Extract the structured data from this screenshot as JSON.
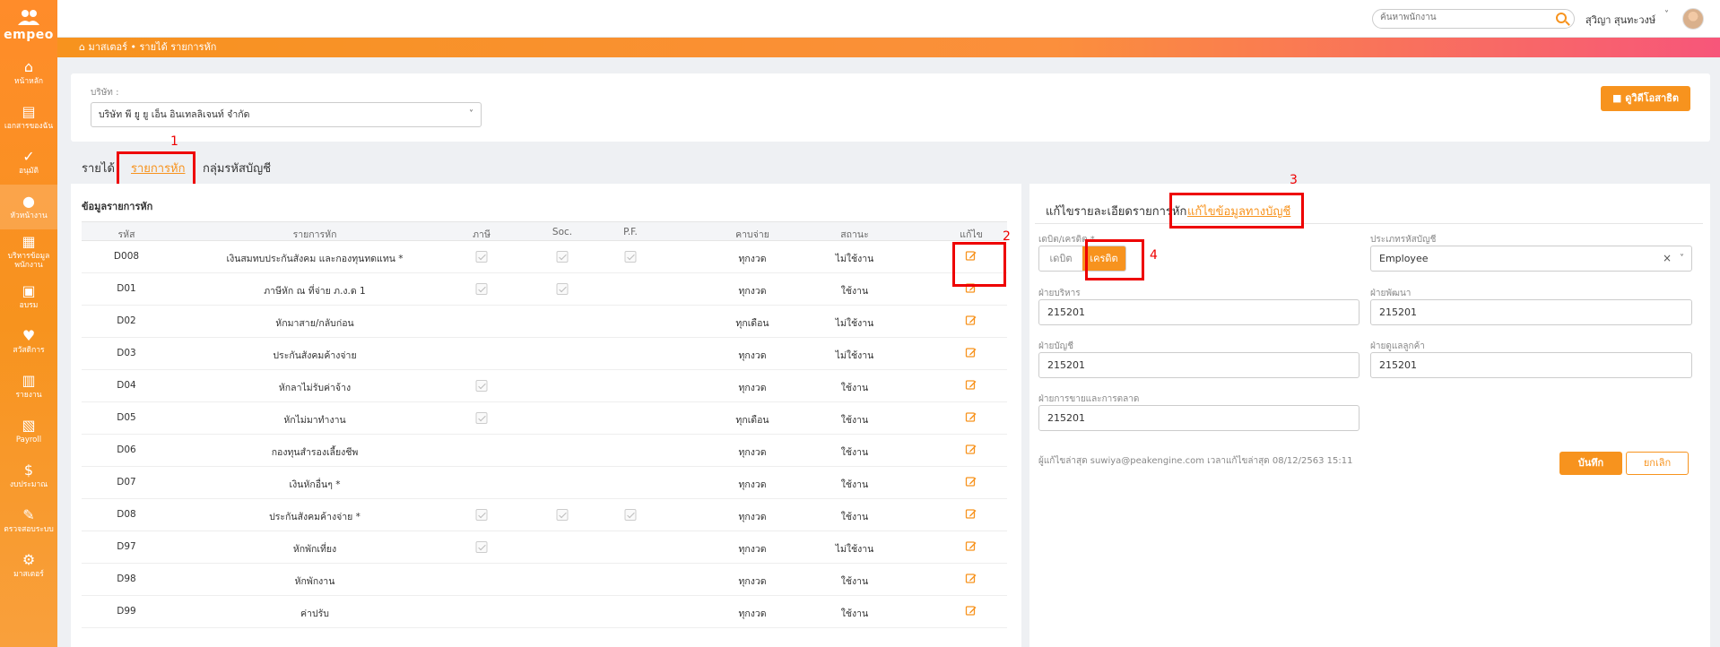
{
  "app": {
    "logo_text": "empeo"
  },
  "sidebar": {
    "items": [
      {
        "label": "หน้าหลัก",
        "icon": "home-icon"
      },
      {
        "label": "เอกสารของฉัน",
        "icon": "document-icon"
      },
      {
        "label": "อนุมัติ",
        "icon": "approve-icon"
      },
      {
        "label": "หัวหน้างาน",
        "icon": "supervisor-icon"
      },
      {
        "label": "บริหารข้อมูล พนักงาน",
        "icon": "employee-data-icon"
      },
      {
        "label": "อบรม",
        "icon": "training-icon"
      },
      {
        "label": "สวัสดิการ",
        "icon": "welfare-icon"
      },
      {
        "label": "รายงาน",
        "icon": "report-icon"
      },
      {
        "label": "Payroll",
        "icon": "payroll-icon"
      },
      {
        "label": "งบประมาณ",
        "icon": "budget-icon"
      },
      {
        "label": "ตรวจสอบระบบ",
        "icon": "audit-icon"
      },
      {
        "label": "มาสเตอร์",
        "icon": "master-icon"
      }
    ]
  },
  "topbar": {
    "search_placeholder": "ค้นหาพนักงาน",
    "user_name": "สุวิญา สุนทะวงษ์"
  },
  "breadcrumb": {
    "text": "มาสเตอร์ • รายได้ รายการหัก"
  },
  "company": {
    "label": "บริษัท :",
    "value": "บริษัท พี ยู ยู เอ็น อินเทลลิเจนท์ จำกัด",
    "video_button": "ดูวิดีโอสาธิต"
  },
  "tabs": [
    "รายได้",
    "รายการหัก",
    "กลุ่มรหัสบัญชี"
  ],
  "annotations": [
    "1",
    "2",
    "3",
    "4"
  ],
  "deduction_table": {
    "title": "ข้อมูลรายการหัก",
    "headers": [
      "รหัส",
      "รายการหัก",
      "ภาษี",
      "Soc.",
      "P.F.",
      "คาบจ่าย",
      "สถานะ",
      "แก้ไข"
    ],
    "rows": [
      {
        "code": "D008",
        "name": "เงินสมทบประกันสังคม และกองทุนทดแทน *",
        "tax": true,
        "soc": true,
        "pf": true,
        "period": "ทุกงวด",
        "status": "ไม่ใช้งาน"
      },
      {
        "code": "D01",
        "name": "ภาษีหัก ณ ที่จ่าย ภ.ง.ด 1",
        "tax": true,
        "soc": true,
        "pf": false,
        "period": "ทุกงวด",
        "status": "ใช้งาน"
      },
      {
        "code": "D02",
        "name": "หักมาสาย/กลับก่อน",
        "tax": false,
        "soc": false,
        "pf": false,
        "period": "ทุกเดือน",
        "status": "ไม่ใช้งาน"
      },
      {
        "code": "D03",
        "name": "ประกันสังคมค้างจ่าย",
        "tax": false,
        "soc": false,
        "pf": false,
        "period": "ทุกงวด",
        "status": "ไม่ใช้งาน"
      },
      {
        "code": "D04",
        "name": "หักลาไม่รับค่าจ้าง",
        "tax": true,
        "soc": false,
        "pf": false,
        "period": "ทุกงวด",
        "status": "ใช้งาน"
      },
      {
        "code": "D05",
        "name": "หักไม่มาทำงาน",
        "tax": true,
        "soc": false,
        "pf": false,
        "period": "ทุกเดือน",
        "status": "ใช้งาน"
      },
      {
        "code": "D06",
        "name": "กองทุนสำรองเลี้ยงชีพ",
        "tax": false,
        "soc": false,
        "pf": false,
        "period": "ทุกงวด",
        "status": "ใช้งาน"
      },
      {
        "code": "D07",
        "name": "เงินหักอื่นๆ *",
        "tax": false,
        "soc": false,
        "pf": false,
        "period": "ทุกงวด",
        "status": "ใช้งาน"
      },
      {
        "code": "D08",
        "name": "ประกันสังคมค้างจ่าย *",
        "tax": true,
        "soc": true,
        "pf": true,
        "period": "ทุกงวด",
        "status": "ใช้งาน"
      },
      {
        "code": "D97",
        "name": "หักพักเที่ยง",
        "tax": true,
        "soc": false,
        "pf": false,
        "period": "ทุกงวด",
        "status": "ไม่ใช้งาน"
      },
      {
        "code": "D98",
        "name": "หักพักงาน",
        "tax": false,
        "soc": false,
        "pf": false,
        "period": "ทุกงวด",
        "status": "ใช้งาน"
      },
      {
        "code": "D99",
        "name": "ค่าปรับ",
        "tax": false,
        "soc": false,
        "pf": false,
        "period": "ทุกงวด",
        "status": "ใช้งาน"
      }
    ]
  },
  "edit_panel": {
    "tabs": [
      "แก้ไขรายละเอียดรายการหัก",
      "แก้ไขข้อมูลทางบัญชี"
    ],
    "debit_credit_label": "เดบิต/เครดิต *",
    "debit_label": "เดบิต",
    "credit_label": "เครดิต",
    "account_type_label": "ประเภทรหัสบัญชี",
    "account_type_value": "Employee",
    "fields": [
      {
        "label": "ฝ่ายบริหาร",
        "value": "215201"
      },
      {
        "label": "ฝ่ายพัฒนา",
        "value": "215201"
      },
      {
        "label": "ฝ่ายบัญชี",
        "value": "215201"
      },
      {
        "label": "ฝ่ายดูแลลูกค้า",
        "value": "215201"
      },
      {
        "label": "ฝ่ายการขายและการตลาด",
        "value": "215201"
      }
    ],
    "audit_text": "ผู้แก้ไขล่าสุด suwiya@peakengine.com เวลาแก้ไขล่าสุด 08/12/2563 15:11",
    "save_button": "บันทึก",
    "cancel_button": "ยกเลิก"
  },
  "colors": {
    "accent": "#f7931e",
    "annotation_red": "#e00000"
  }
}
